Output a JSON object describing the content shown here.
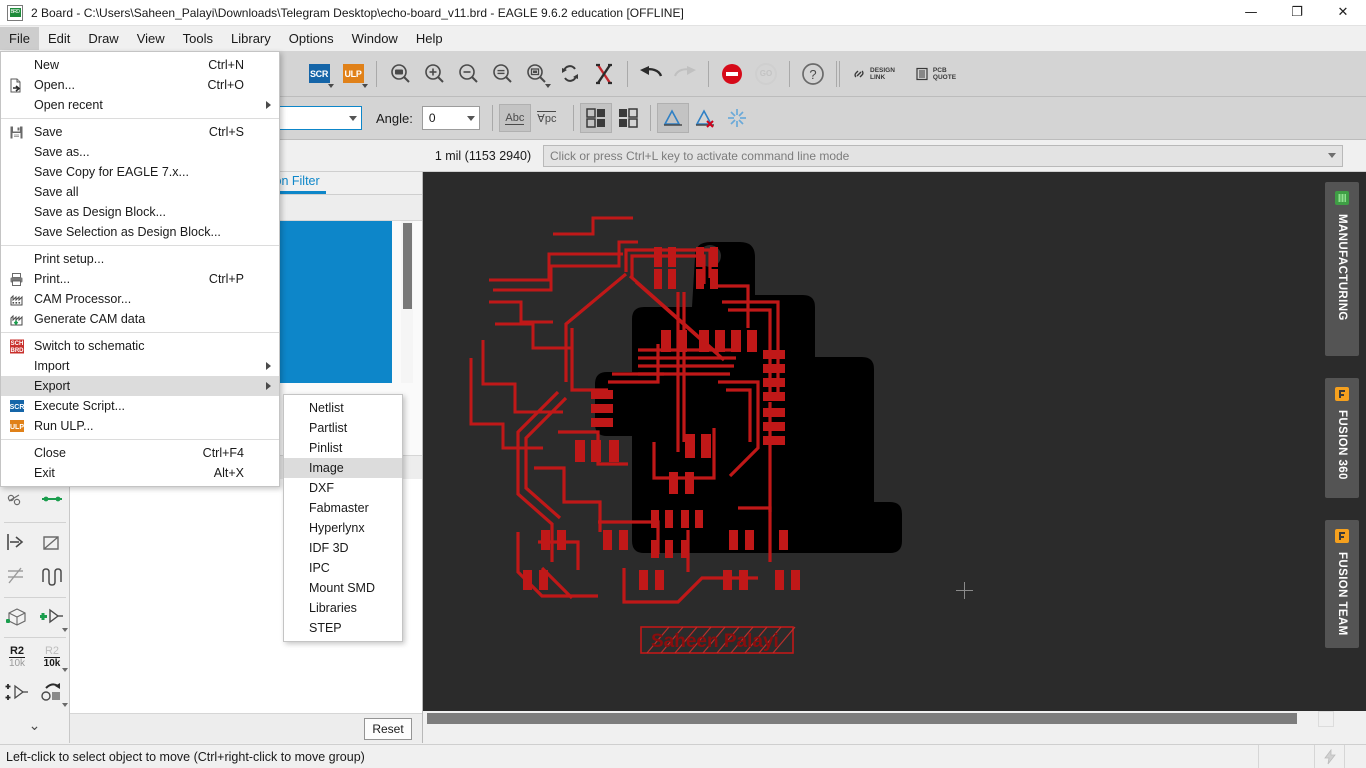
{
  "window": {
    "title": "2 Board - C:\\Users\\Saheen_Palayi\\Downloads\\Telegram Desktop\\echo-board_v11.brd - EAGLE 9.6.2 education [OFFLINE]",
    "app_icon": "brd",
    "minimize": "—",
    "maximize": "❐",
    "close": "✕"
  },
  "menubar": {
    "items": [
      {
        "label": "File",
        "active": true
      },
      {
        "label": "Edit",
        "active": false
      },
      {
        "label": "Draw",
        "active": false
      },
      {
        "label": "View",
        "active": false
      },
      {
        "label": "Tools",
        "active": false
      },
      {
        "label": "Library",
        "active": false
      },
      {
        "label": "Options",
        "active": false
      },
      {
        "label": "Window",
        "active": false
      },
      {
        "label": "Help",
        "active": false
      }
    ]
  },
  "file_menu": {
    "items": [
      {
        "label": "New",
        "accel": "Ctrl+N",
        "icon": "",
        "submenu": false,
        "highlight": false
      },
      {
        "label": "Open...",
        "accel": "Ctrl+O",
        "icon": "open-file-icon",
        "submenu": false,
        "highlight": false
      },
      {
        "label": "Open recent",
        "accel": "",
        "icon": "",
        "submenu": true,
        "highlight": false
      },
      {
        "divider": true
      },
      {
        "label": "Save",
        "accel": "Ctrl+S",
        "icon": "floppy-disk-icon",
        "submenu": false,
        "highlight": false
      },
      {
        "label": "Save as...",
        "accel": "",
        "icon": "",
        "submenu": false,
        "highlight": false
      },
      {
        "label": "Save Copy for EAGLE 7.x...",
        "accel": "",
        "icon": "",
        "submenu": false,
        "highlight": false
      },
      {
        "label": "Save all",
        "accel": "",
        "icon": "",
        "submenu": false,
        "highlight": false
      },
      {
        "label": "Save as Design Block...",
        "accel": "",
        "icon": "",
        "submenu": false,
        "highlight": false
      },
      {
        "label": "Save Selection as Design Block...",
        "accel": "",
        "icon": "",
        "submenu": false,
        "highlight": false
      },
      {
        "divider": true
      },
      {
        "label": "Print setup...",
        "accel": "",
        "icon": "",
        "submenu": false,
        "highlight": false
      },
      {
        "label": "Print...",
        "accel": "Ctrl+P",
        "icon": "printer-icon",
        "submenu": false,
        "highlight": false
      },
      {
        "label": "CAM Processor...",
        "accel": "",
        "icon": "cam-icon",
        "submenu": false,
        "highlight": false
      },
      {
        "label": "Generate CAM data",
        "accel": "",
        "icon": "cam-data-icon",
        "submenu": false,
        "highlight": false
      },
      {
        "label": "Switch to schematic",
        "accel": "",
        "icon": "sch-brd-icon",
        "submenu": false,
        "highlight": false
      },
      {
        "label": "Import",
        "accel": "",
        "icon": "",
        "submenu": true,
        "highlight": false
      },
      {
        "label": "Export",
        "accel": "",
        "icon": "",
        "submenu": true,
        "highlight": true
      },
      {
        "label": "Execute Script...",
        "accel": "",
        "icon": "scr-icon",
        "submenu": false,
        "highlight": false
      },
      {
        "label": "Run ULP...",
        "accel": "",
        "icon": "ulp-icon",
        "submenu": false,
        "highlight": false
      },
      {
        "divider": true
      },
      {
        "label": "Close",
        "accel": "Ctrl+F4",
        "icon": "",
        "submenu": false,
        "highlight": false
      },
      {
        "label": "Exit",
        "accel": "Alt+X",
        "icon": "",
        "submenu": false,
        "highlight": false
      }
    ]
  },
  "export_menu": {
    "items": [
      {
        "label": "Netlist",
        "highlight": false
      },
      {
        "label": "Partlist",
        "highlight": false
      },
      {
        "label": "Pinlist",
        "highlight": false
      },
      {
        "label": "Image",
        "highlight": true
      },
      {
        "label": "DXF",
        "highlight": false
      },
      {
        "label": "Fabmaster",
        "highlight": false
      },
      {
        "label": "Hyperlynx",
        "highlight": false
      },
      {
        "label": "IDF 3D",
        "highlight": false
      },
      {
        "label": "IPC",
        "highlight": false
      },
      {
        "label": "Mount SMD",
        "highlight": false
      },
      {
        "label": "Libraries",
        "highlight": false
      },
      {
        "label": "STEP",
        "highlight": false
      }
    ]
  },
  "toolbar1": {
    "scr_button": "SCR",
    "ulp_button": "ULP",
    "zoom_fit": "zoom-fit-icon",
    "zoom_in": "zoom-in-icon",
    "zoom_out": "zoom-out-icon",
    "zoom_redraw": "zoom-redraw-icon",
    "zoom_select": "zoom-select-icon",
    "refresh": "refresh-icon",
    "stop_cross": "stop-cross-icon",
    "undo": "undo-icon",
    "redo": "redo-icon",
    "stop": "stop-icon",
    "go": "GO",
    "help": "help-icon",
    "design_link_line1": "DESIGN",
    "design_link_line2": "LINK",
    "pcb_quote_line1": "PCB",
    "pcb_quote_line2": "QUOTE"
  },
  "toolbar2": {
    "grid_combo_value": "",
    "angle_label": "Angle:",
    "angle_value": "0",
    "abc_button": "Abc",
    "vpc_button": "∀pc",
    "select_all_icon": "select-all-icon",
    "select_none_icon": "select-none-icon",
    "ratsnest_icon": "ratsnest-icon",
    "ratsnest_off_icon": "ratsnest-off-icon",
    "highlight_icon": "highlight-icon"
  },
  "info_row": {
    "coordinates": "1 mil (1153 2940)",
    "command_line_placeholder": "Click or press Ctrl+L key to activate command line mode"
  },
  "left_dock": {
    "tab_label": "ction Filter",
    "reset_button": "Reset",
    "layer_color_primary": "#0d86c9"
  },
  "canvas": {
    "background_color": "#2b2b2b",
    "board_outline_color": "#000000",
    "trace_color": "#c01818",
    "silk_text": "Saheen Palayi"
  },
  "right_tabs": [
    {
      "label": "MANUFACTURING",
      "icon": "chip-icon",
      "icon_color": "#4caf50"
    },
    {
      "label": "FUSION 360",
      "icon": "fusion-icon",
      "icon_color": "#f5a01e"
    },
    {
      "label": "FUSION TEAM",
      "icon": "fusion-icon",
      "icon_color": "#f5a01e"
    }
  ],
  "status_bar": {
    "message": "Left-click to select object to move (Ctrl+right-click to move group)",
    "lightning_icon": "lightning-icon"
  }
}
